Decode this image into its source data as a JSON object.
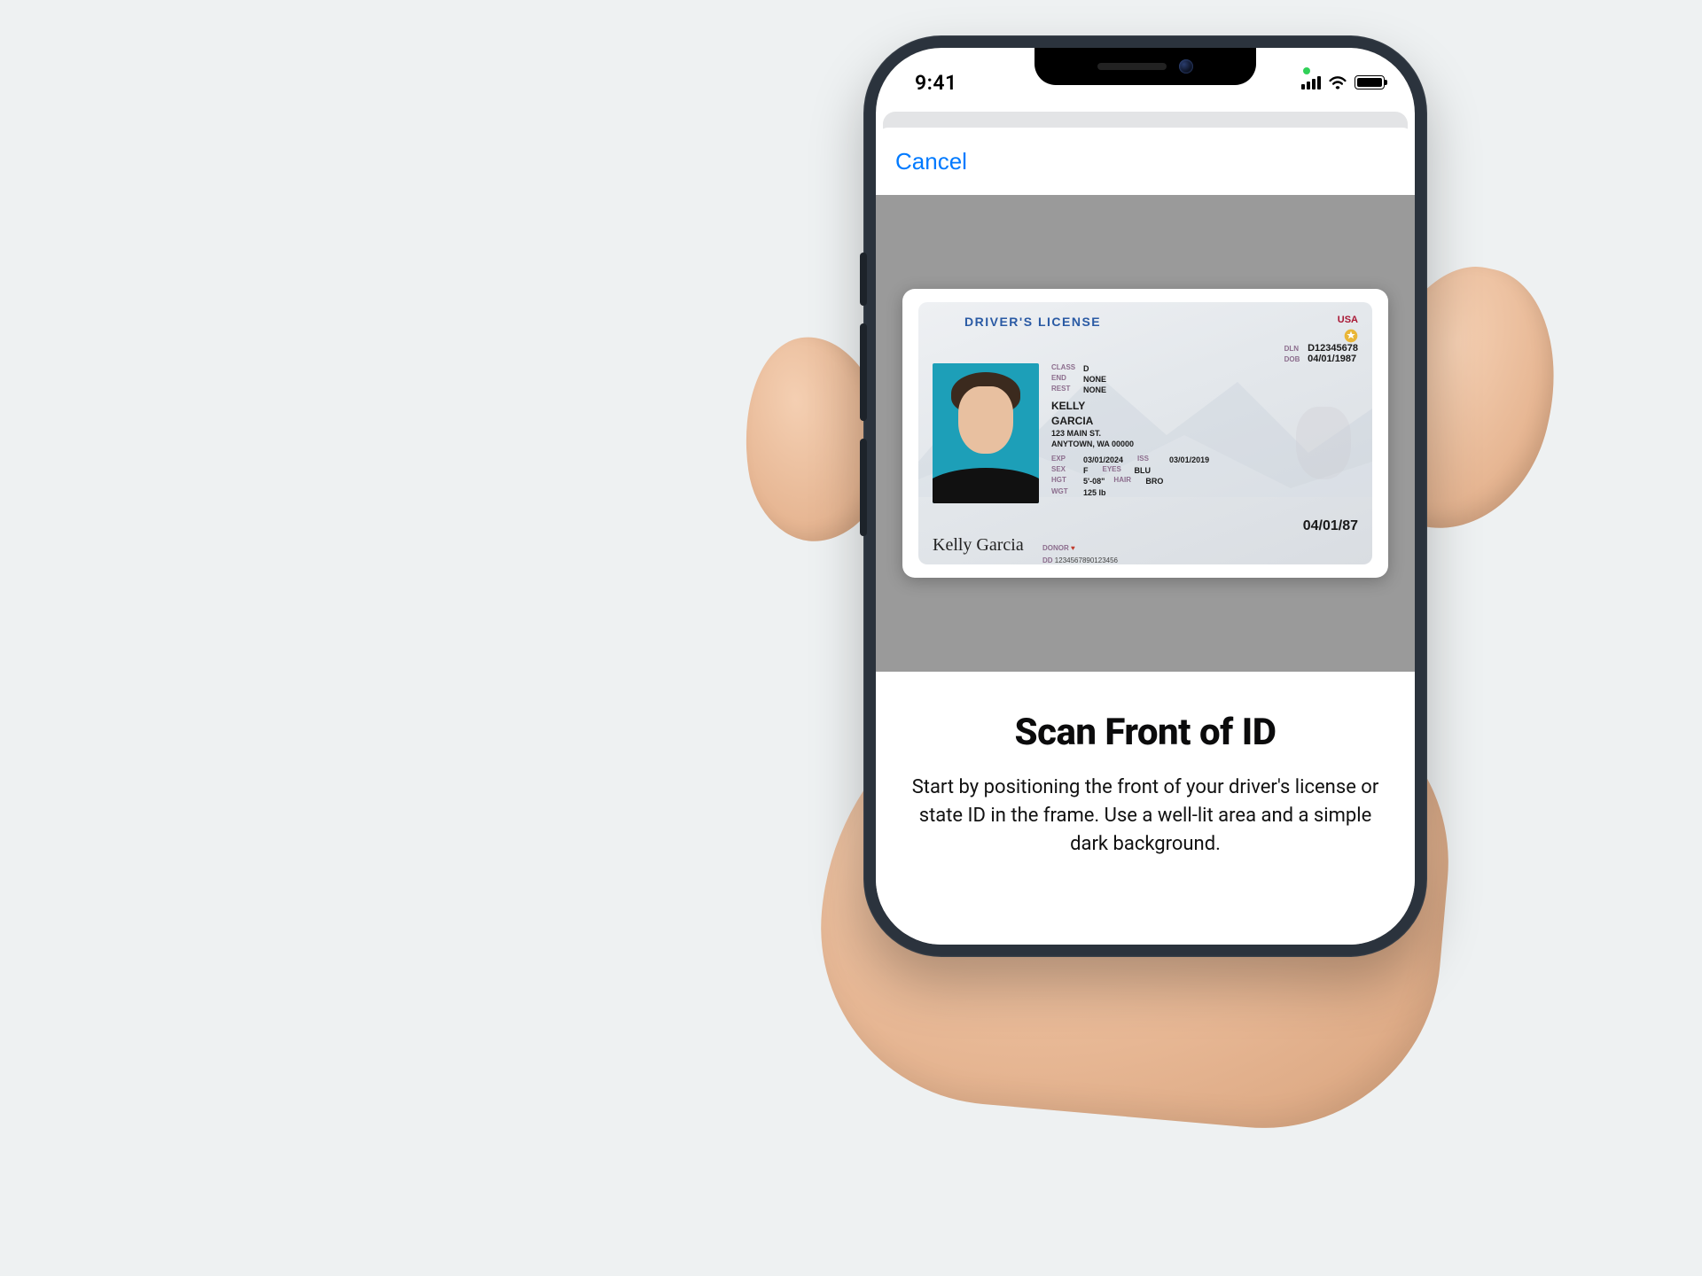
{
  "status_bar": {
    "time": "9:41"
  },
  "modal": {
    "cancel_label": "Cancel"
  },
  "instructions": {
    "title": "Scan Front of ID",
    "body": "Start by positioning the front of your driver's license or state ID in the frame. Use a well-lit area and a simple dark background."
  },
  "id_card": {
    "title": "DRIVER'S LICENSE",
    "country": "USA",
    "name_last": "KELLY",
    "name_first": "GARCIA",
    "address_line1": "123 MAIN ST.",
    "address_line2": "ANYTOWN, WA 00000",
    "class_label": "CLASS",
    "class_value": "D",
    "end_label": "END",
    "end_value": "NONE",
    "rest_label": "REST",
    "rest_value": "NONE",
    "dln_label": "DLN",
    "dln_value": "D12345678",
    "dob_label": "DOB",
    "dob_value": "04/01/1987",
    "exp_label": "EXP",
    "exp_value": "03/01/2024",
    "iss_label": "ISS",
    "iss_value": "03/01/2019",
    "sex_label": "SEX",
    "sex_value": "F",
    "eyes_label": "EYES",
    "eyes_value": "BLU",
    "hgt_label": "HGT",
    "hgt_value": "5'-08\"",
    "hair_label": "HAIR",
    "hair_value": "BRO",
    "wgt_label": "WGT",
    "wgt_value": "125 lb",
    "donor_label": "DONOR",
    "big_date": "04/01/87",
    "dd_label": "DD",
    "dd_value": "1234567890123456",
    "signature": "Kelly Garcia"
  }
}
